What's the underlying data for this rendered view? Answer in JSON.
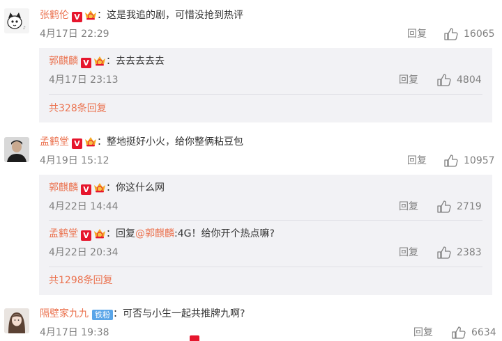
{
  "comments": [
    {
      "user": "张鹤伦",
      "text": "：这是我追的剧，可惜没抢到热评",
      "time": "4月17日 22:29",
      "reply_label": "回复",
      "likes": "16065",
      "replies": [
        {
          "user": "郭麒麟",
          "text": "：去去去去去",
          "time": "4月17日 23:13",
          "reply_label": "回复",
          "likes": "4804"
        }
      ],
      "more_label": "共328条回复"
    },
    {
      "user": "孟鹤堂",
      "text": "：整地挺好小火，给你整俩粘豆包",
      "time": "4月19日 15:12",
      "reply_label": "回复",
      "likes": "10957",
      "replies": [
        {
          "user": "郭麒麟",
          "text": "：你这什么网",
          "time": "4月22日 14:44",
          "reply_label": "回复",
          "likes": "2719"
        },
        {
          "user": "孟鹤堂",
          "text_prefix": "：回复",
          "mention": "@郭麒麟",
          "text": ":4G！给你开个热点嘛?",
          "time": "4月22日 20:34",
          "reply_label": "回复",
          "likes": "2383"
        }
      ],
      "more_label": "共1298条回复"
    },
    {
      "user": "隔壁家九九",
      "badge": "铁粉",
      "text": "：可否与小生一起共推牌九啊?",
      "time": "4月17日 19:38",
      "reply_label": "回复",
      "likes": "6634"
    }
  ],
  "icons": {
    "verified": "verified-v-icon",
    "crown": "crown-member-icon",
    "like": "thumbs-up-icon"
  },
  "colors": {
    "username": "#eb7350",
    "verified": "#e6162d",
    "fan_badge": "#5aa5e8",
    "reply_box": "#f2f2f5"
  }
}
